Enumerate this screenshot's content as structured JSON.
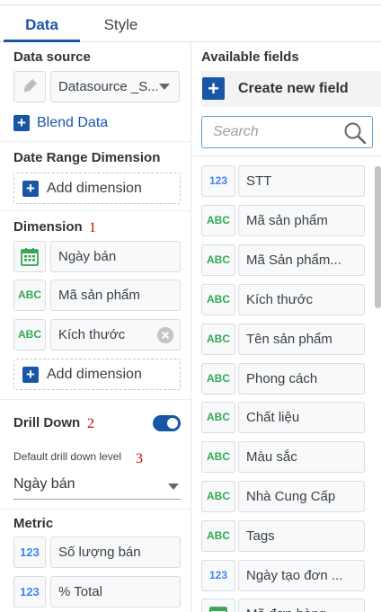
{
  "tabs": {
    "data": "Data",
    "style": "Style"
  },
  "data_source": {
    "title": "Data source",
    "datasource_name": "Datasource _S...",
    "blend_label": "Blend Data"
  },
  "date_range": {
    "title": "Date Range Dimension",
    "add_label": "Add dimension"
  },
  "dimension": {
    "title": "Dimension",
    "annotation": "1",
    "items": [
      {
        "type": "date-icon",
        "label": "Ngày bán"
      },
      {
        "type": "ABC",
        "label": "Mã sản phẩm"
      },
      {
        "type": "ABC",
        "label": "Kích thước"
      }
    ],
    "add_label": "Add dimension"
  },
  "drill_down": {
    "title": "Drill Down",
    "annotation": "2",
    "enabled": true,
    "level_label": "Default drill down level",
    "level_annotation": "3",
    "level_value": "Ngày bán"
  },
  "metric": {
    "title": "Metric",
    "items": [
      {
        "type": "123",
        "label": "Số lượng bán"
      },
      {
        "type": "123",
        "label": "% Total"
      }
    ]
  },
  "available_fields": {
    "title": "Available fields",
    "create_label": "Create new field",
    "search_placeholder": "Search",
    "fields": [
      {
        "type": "123",
        "label": "STT"
      },
      {
        "type": "ABC",
        "label": "Mã sản phẩm"
      },
      {
        "type": "ABC",
        "label": "Mã Sản phẩm..."
      },
      {
        "type": "ABC",
        "label": "Kích thước"
      },
      {
        "type": "ABC",
        "label": "Tên sản phẩm"
      },
      {
        "type": "ABC",
        "label": "Phong cách"
      },
      {
        "type": "ABC",
        "label": "Chất liệu"
      },
      {
        "type": "ABC",
        "label": "Màu sắc"
      },
      {
        "type": "ABC",
        "label": "Nhà Cung Cấp"
      },
      {
        "type": "ABC",
        "label": "Tags"
      },
      {
        "type": "123",
        "label": "Ngày tạo đơn ..."
      },
      {
        "type": "date-icon",
        "label": "Mã đơn hàng"
      }
    ]
  },
  "colors": {
    "accent": "#1a56a6",
    "text_type": "#34a853",
    "number_type": "#4285f4",
    "annotation": "#d00000"
  }
}
